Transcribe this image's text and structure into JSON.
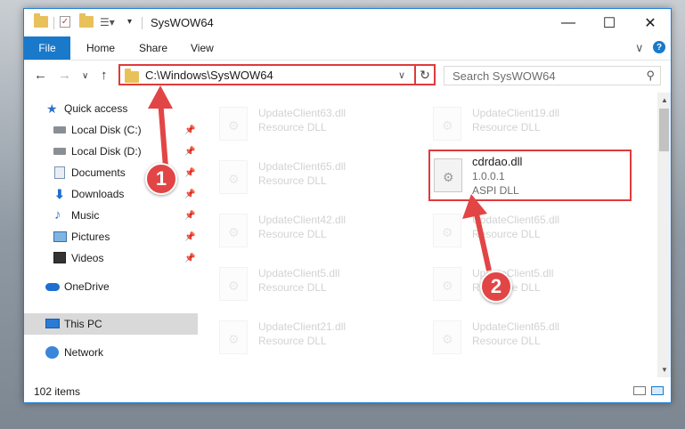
{
  "window": {
    "title": "SysWOW64"
  },
  "window_controls": {
    "minimize": "—",
    "maximize": "☐",
    "close": "✕"
  },
  "ribbon": {
    "tabs": [
      "File",
      "Home",
      "Share",
      "View"
    ],
    "expand_glyph": "∨",
    "help_glyph": "?"
  },
  "navigation": {
    "back_glyph": "←",
    "forward_glyph": "→",
    "recent_glyph": "∨",
    "up_glyph": "↑",
    "address": "C:\\Windows\\SysWOW64",
    "refresh_glyph": "↻",
    "search_placeholder": "Search SysWOW64",
    "search_glyph": "⚲"
  },
  "sidebar": {
    "items": [
      {
        "label": "Quick access",
        "icon": "star-icon",
        "pinned": false
      },
      {
        "label": "Local Disk (C:)",
        "icon": "disk-icon",
        "pinned": true
      },
      {
        "label": "Local Disk (D:)",
        "icon": "disk-icon",
        "pinned": true
      },
      {
        "label": "Documents",
        "icon": "documents-icon",
        "pinned": true
      },
      {
        "label": "Downloads",
        "icon": "downloads-icon",
        "pinned": true
      },
      {
        "label": "Music",
        "icon": "music-icon",
        "pinned": true
      },
      {
        "label": "Pictures",
        "icon": "pictures-icon",
        "pinned": true
      },
      {
        "label": "Videos",
        "icon": "videos-icon",
        "pinned": true
      },
      {
        "label": "OneDrive",
        "icon": "cloud-icon",
        "pinned": false
      },
      {
        "label": "This PC",
        "icon": "computer-icon",
        "pinned": false,
        "selected": true
      },
      {
        "label": "Network",
        "icon": "network-icon",
        "pinned": false
      }
    ]
  },
  "files": {
    "left_column": [
      {
        "name": "UpdateClient63.dll",
        "desc": "Resource DLL"
      },
      {
        "name": "UpdateClient65.dll",
        "desc": "Resource DLL"
      },
      {
        "name": "UpdateClient42.dll",
        "desc": "Resource DLL"
      },
      {
        "name": "UpdateClient5.dll",
        "desc": "Resource DLL"
      },
      {
        "name": "UpdateClient21.dll",
        "desc": "Resource DLL"
      }
    ],
    "right_column": [
      {
        "name": "UpdateClient19.dll",
        "desc": "Resource DLL"
      },
      {
        "name": "UpdateClient65.dll",
        "desc": "Resource DLL"
      },
      {
        "name": "UpdateClient5.dll",
        "desc": "Resource DLL"
      },
      {
        "name": "UpdateClient65.dll",
        "desc": "Resource DLL"
      }
    ],
    "highlighted": {
      "name": "cdrdao.dll",
      "version": "1.0.0.1",
      "type": "ASPI DLL"
    }
  },
  "status": {
    "item_count": "102 items"
  },
  "annotations": {
    "step1": "1",
    "step2": "2",
    "color": "#e24545"
  }
}
